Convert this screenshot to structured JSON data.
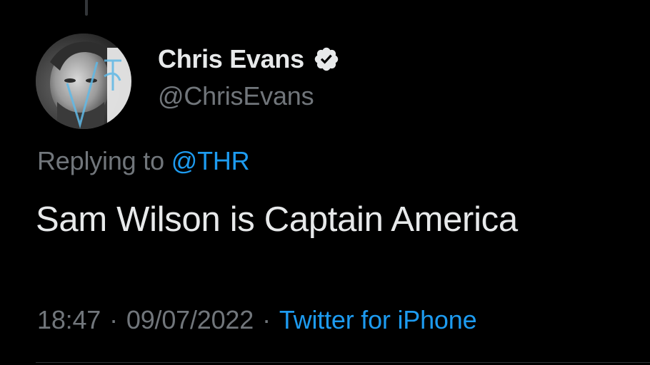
{
  "tweet": {
    "author": {
      "display_name": "Chris Evans",
      "handle": "@ChrisEvans",
      "verified": true,
      "avatar_icon": "avatar-photo"
    },
    "reply": {
      "prefix": "Replying to",
      "mention": "@THR"
    },
    "text": "Sam Wilson is Captain America",
    "meta": {
      "time": "18:47",
      "date": "09/07/2022",
      "separator": "·",
      "source": "Twitter for iPhone"
    }
  },
  "colors": {
    "background": "#000000",
    "primary_text": "#e7e9ea",
    "secondary_text": "#71767b",
    "accent": "#1d9bf0"
  }
}
